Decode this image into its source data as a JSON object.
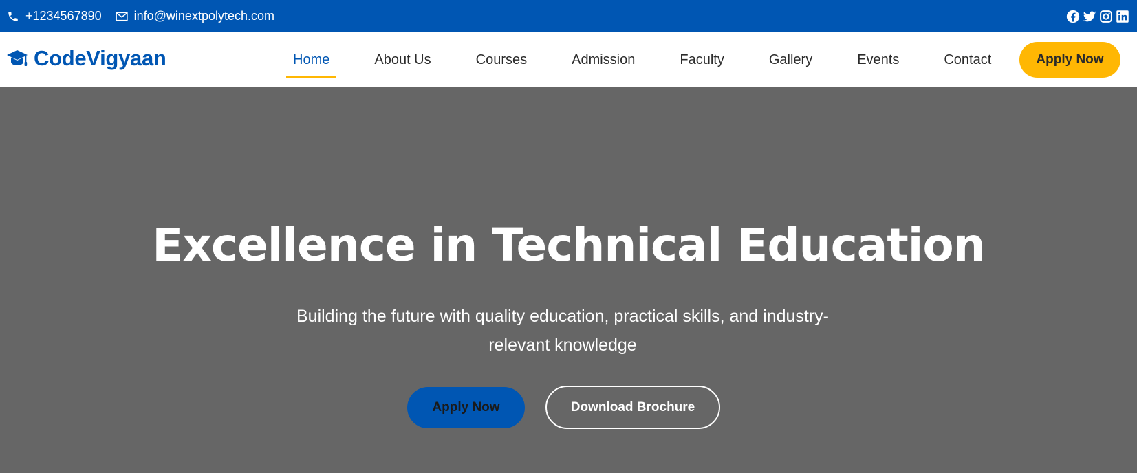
{
  "topbar": {
    "phone": "+1234567890",
    "email": "info@winextpolytech.com",
    "socials": [
      "facebook-icon",
      "twitter-icon",
      "instagram-icon",
      "linkedin-icon"
    ],
    "background": "#0056b3"
  },
  "navbar": {
    "brand": "CodeVigyaan",
    "brand_icon": "graduation-cap-icon",
    "menu": [
      {
        "label": "Home",
        "active": true
      },
      {
        "label": "About Us"
      },
      {
        "label": "Courses"
      },
      {
        "label": "Admission"
      },
      {
        "label": "Faculty"
      },
      {
        "label": "Gallery"
      },
      {
        "label": "Events"
      },
      {
        "label": "Contact"
      }
    ],
    "apply_label": "Apply Now"
  },
  "hero": {
    "title": "Excellence in Technical Education",
    "subtitle": "Building the future with quality education, practical skills, and industry-relevant knowledge",
    "primary_button": "Apply Now",
    "secondary_button": "Download Brochure"
  },
  "colors": {
    "primary": "#0056b3",
    "accent": "#ffb703",
    "hero_bg": "#666666"
  }
}
